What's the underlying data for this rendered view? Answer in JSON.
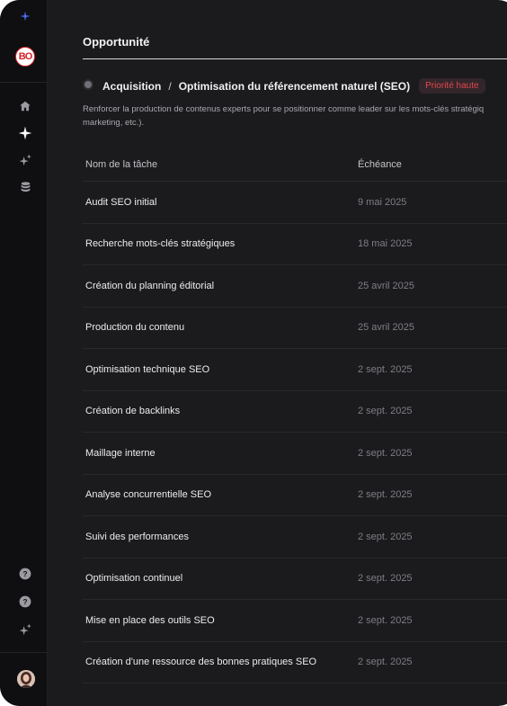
{
  "sidebar": {
    "logo_text": "BO",
    "nav": [
      {
        "icon": "home-icon"
      },
      {
        "icon": "sparkle-icon"
      },
      {
        "icon": "sparkles-icon"
      },
      {
        "icon": "database-icon"
      }
    ],
    "bottom": [
      {
        "icon": "help-icon"
      },
      {
        "icon": "help-icon"
      },
      {
        "icon": "sparkles-icon"
      }
    ]
  },
  "page": {
    "title": "Opportunité",
    "breadcrumb": {
      "parent": "Acquisition",
      "separator": "/",
      "current": "Optimisation du référencement naturel (SEO)",
      "priority": "Priorité haute"
    },
    "description": "Renforcer la production de contenus experts pour se positionner comme leader sur les mots-clés stratégiq marketing, etc.)."
  },
  "table": {
    "headers": {
      "name": "Nom de la tâche",
      "due": "Échéance"
    },
    "rows": [
      {
        "name": "Audit SEO initial",
        "due": "9 mai 2025"
      },
      {
        "name": "Recherche mots-clés stratégiques",
        "due": "18 mai 2025"
      },
      {
        "name": "Création du planning éditorial",
        "due": "25 avril 2025"
      },
      {
        "name": "Production du contenu",
        "due": "25 avril 2025"
      },
      {
        "name": "Optimisation technique SEO",
        "due": "2 sept. 2025"
      },
      {
        "name": "Création de backlinks",
        "due": "2 sept. 2025"
      },
      {
        "name": "Maillage interne",
        "due": "2 sept. 2025"
      },
      {
        "name": "Analyse concurrentielle SEO",
        "due": "2 sept. 2025"
      },
      {
        "name": "Suivi des performances",
        "due": "2 sept. 2025"
      },
      {
        "name": "Optimisation continuel",
        "due": "2 sept. 2025"
      },
      {
        "name": "Mise en place des outils SEO",
        "due": "2 sept. 2025"
      },
      {
        "name": "Création d'une ressource des bonnes pratiques SEO",
        "due": "2 sept. 2025"
      }
    ]
  },
  "colors": {
    "accent": "#4a6cf7",
    "priority": "#e2474d",
    "background": "#1b1b1e"
  }
}
